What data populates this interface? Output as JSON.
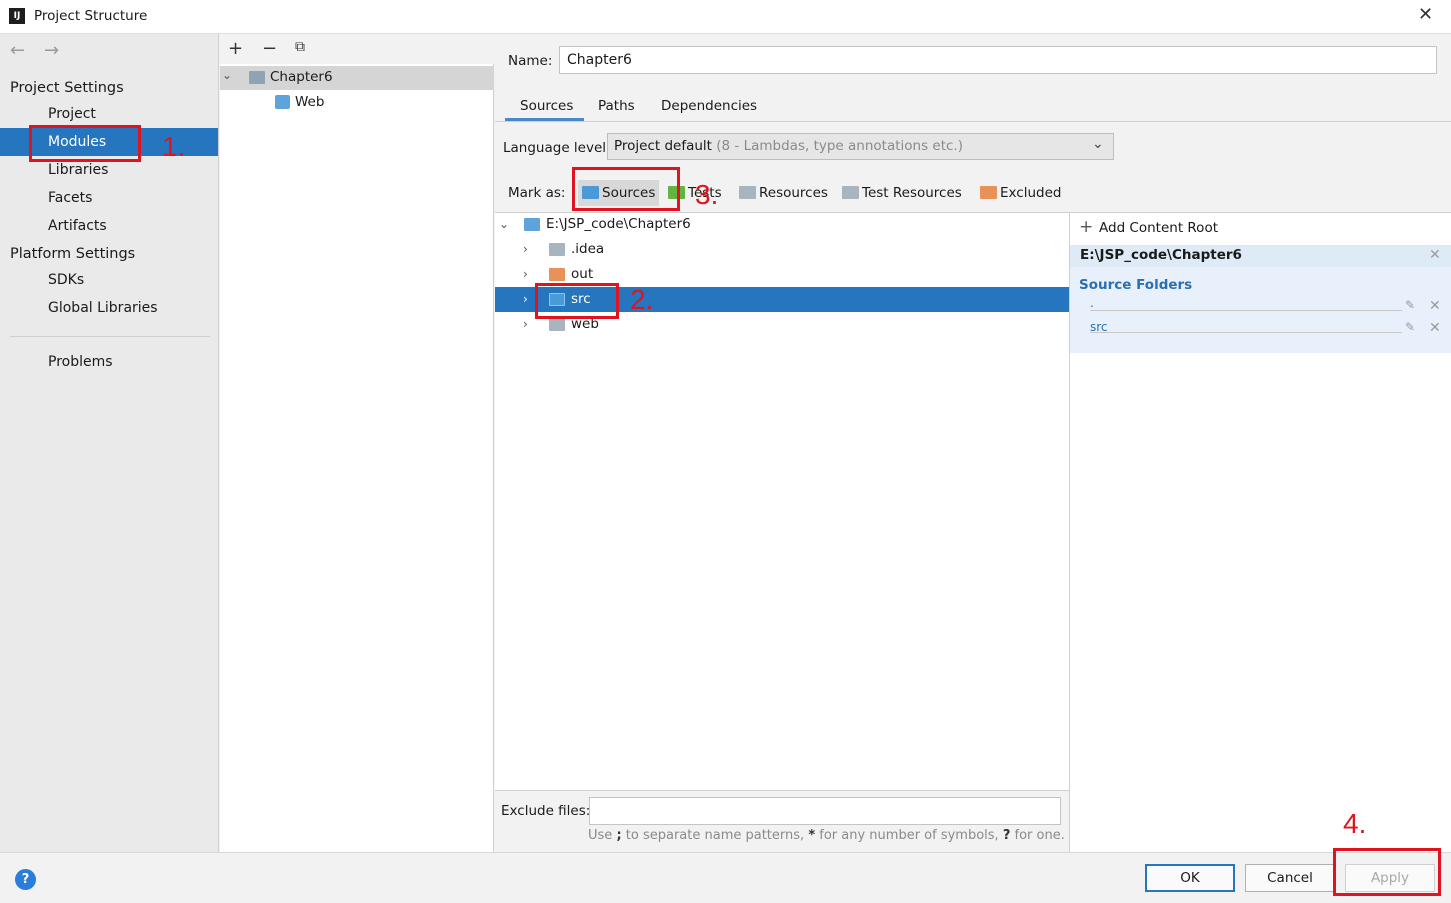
{
  "window": {
    "title": "Project Structure",
    "app_icon": "IJ"
  },
  "sidebar": {
    "project_settings": "Project Settings",
    "project_items": [
      "Project",
      "Modules",
      "Libraries",
      "Facets",
      "Artifacts"
    ],
    "platform_settings": "Platform Settings",
    "platform_items": [
      "SDKs",
      "Global Libraries"
    ],
    "problems": "Problems",
    "selected": "Modules"
  },
  "modules": {
    "items": [
      {
        "label": "Chapter6"
      },
      {
        "label": "Web"
      }
    ]
  },
  "detail": {
    "name_label": "Name:",
    "name_value": "Chapter6",
    "tabs": [
      "Sources",
      "Paths",
      "Dependencies"
    ],
    "active_tab": "Sources",
    "language_label": "Language level:",
    "language_value": "Project default",
    "language_hint": "(8 - Lambdas, type annotations etc.)",
    "mark_as_label": "Mark as:",
    "mark_as": [
      "Sources",
      "Tests",
      "Resources",
      "Test Resources",
      "Excluded"
    ]
  },
  "tree": {
    "root": "E:\\JSP_code\\Chapter6",
    "children": [
      ".idea",
      "out",
      "src",
      "web"
    ],
    "selected": "src"
  },
  "content_root": {
    "add_label": "Add Content Root",
    "path": "E:\\JSP_code\\Chapter6",
    "source_folders_label": "Source Folders",
    "folders": [
      ".",
      "src"
    ]
  },
  "exclude": {
    "label": "Exclude files:",
    "hint_1": "Use",
    "hint_sep": ";",
    "hint_2": "to separate name patterns,",
    "hint_star": "*",
    "hint_3": "for any number of symbols,",
    "hint_q": "?",
    "hint_4": "for one."
  },
  "buttons": {
    "ok": "OK",
    "cancel": "Cancel",
    "apply": "Apply",
    "help": "?"
  },
  "annotations": [
    "1.",
    "2.",
    "3.",
    "4."
  ],
  "colors": {
    "selection": "#2675bf",
    "annotation": "#e0141e",
    "source_folder": "#4a9ad8",
    "excluded_folder": "#e8925a"
  }
}
